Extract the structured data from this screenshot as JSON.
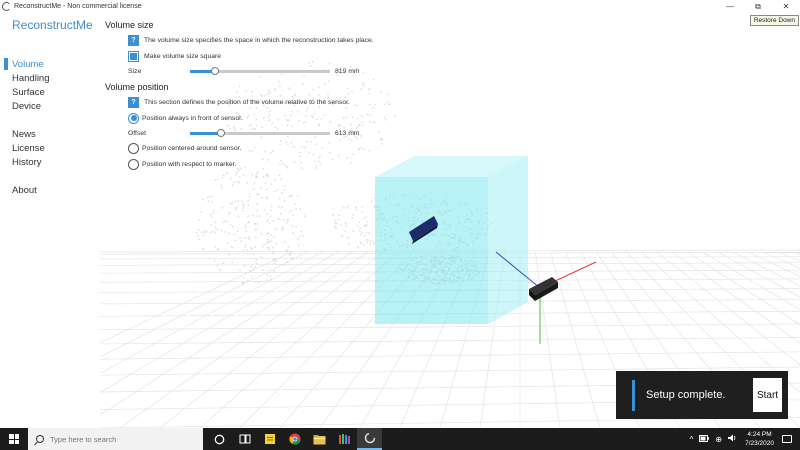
{
  "window": {
    "title": "ReconstructMe - Non commercial license",
    "minimize_glyph": "—",
    "restore_glyph": "⧉",
    "close_glyph": "✕",
    "tooltip": "Restore Down"
  },
  "sidebar": {
    "brand": "ReconstructMe",
    "items_top": [
      {
        "label": "Volume",
        "active": true
      },
      {
        "label": "Handling"
      },
      {
        "label": "Surface"
      },
      {
        "label": "Device"
      }
    ],
    "items_mid": [
      {
        "label": "News"
      },
      {
        "label": "License"
      },
      {
        "label": "History"
      }
    ],
    "items_bottom": [
      {
        "label": "About"
      }
    ]
  },
  "volume_size": {
    "title": "Volume size",
    "info": "The volume size specifies the space in which the reconstruction takes place.",
    "square_label": "Make volume size square",
    "square_checked": true,
    "size_label": "Size",
    "size_value": "819 mm",
    "size_fraction": 0.18
  },
  "volume_position": {
    "title": "Volume position",
    "info": "This section defines the position of the volume relative to the sensor.",
    "option_front": "Position always in front of sensor.",
    "offset_label": "Offset",
    "offset_value": "613 mm",
    "offset_fraction": 0.22,
    "option_centered": "Position centered around sensor.",
    "option_marker": "Position with respect to marker."
  },
  "toast": {
    "message": "Setup complete.",
    "button": "Start"
  },
  "taskbar": {
    "search_placeholder": "Type here to search",
    "tray_up": "^",
    "tray_network": "⊕",
    "time": "4:24 PM",
    "date": "7/23/2020"
  },
  "colors": {
    "accent": "#3b8fd3",
    "volume_cube": "#7fe6f0",
    "axis_x": "#d94040",
    "axis_y": "#40c040",
    "axis_z": "#3050c0"
  }
}
